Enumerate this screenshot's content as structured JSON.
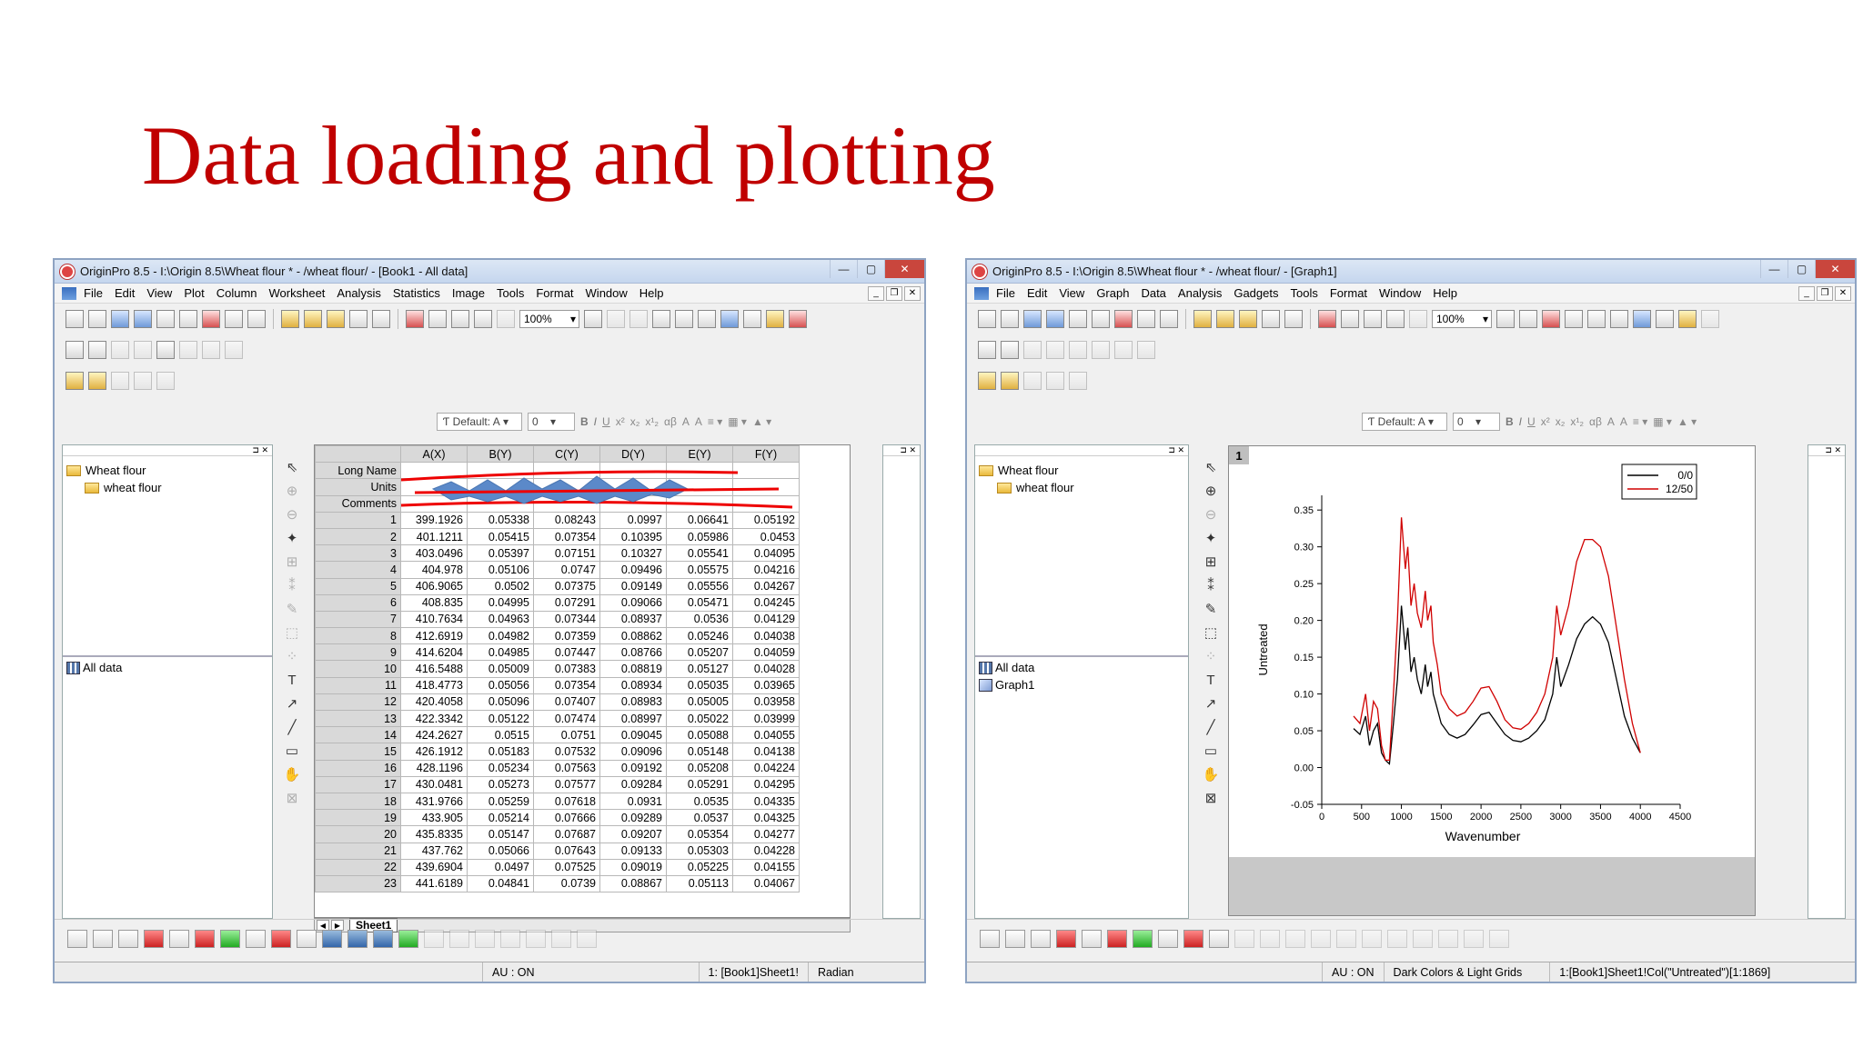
{
  "slide": {
    "title": "Data loading and plotting"
  },
  "left_window": {
    "title": "OriginPro 8.5 - I:\\Origin 8.5\\Wheat flour * - /wheat flour/ - [Book1 - All data]",
    "menu": [
      "File",
      "Edit",
      "View",
      "Plot",
      "Column",
      "Worksheet",
      "Analysis",
      "Statistics",
      "Image",
      "Tools",
      "Format",
      "Window",
      "Help"
    ],
    "zoom": "100%",
    "font_default": "Default: A",
    "font_size": "0",
    "project_tree": {
      "root": "Wheat flour",
      "child": "wheat flour"
    },
    "window_list": [
      "All data"
    ],
    "worksheet": {
      "columns": [
        "A(X)",
        "B(Y)",
        "C(Y)",
        "D(Y)",
        "E(Y)",
        "F(Y)"
      ],
      "meta_rows": [
        "Long Name",
        "Units",
        "Comments"
      ],
      "rows": [
        [
          "1",
          "399.1926",
          "0.05338",
          "0.08243",
          "0.0997",
          "0.06641",
          "0.05192"
        ],
        [
          "2",
          "401.1211",
          "0.05415",
          "0.07354",
          "0.10395",
          "0.05986",
          "0.0453"
        ],
        [
          "3",
          "403.0496",
          "0.05397",
          "0.07151",
          "0.10327",
          "0.05541",
          "0.04095"
        ],
        [
          "4",
          "404.978",
          "0.05106",
          "0.0747",
          "0.09496",
          "0.05575",
          "0.04216"
        ],
        [
          "5",
          "406.9065",
          "0.0502",
          "0.07375",
          "0.09149",
          "0.05556",
          "0.04267"
        ],
        [
          "6",
          "408.835",
          "0.04995",
          "0.07291",
          "0.09066",
          "0.05471",
          "0.04245"
        ],
        [
          "7",
          "410.7634",
          "0.04963",
          "0.07344",
          "0.08937",
          "0.0536",
          "0.04129"
        ],
        [
          "8",
          "412.6919",
          "0.04982",
          "0.07359",
          "0.08862",
          "0.05246",
          "0.04038"
        ],
        [
          "9",
          "414.6204",
          "0.04985",
          "0.07447",
          "0.08766",
          "0.05207",
          "0.04059"
        ],
        [
          "10",
          "416.5488",
          "0.05009",
          "0.07383",
          "0.08819",
          "0.05127",
          "0.04028"
        ],
        [
          "11",
          "418.4773",
          "0.05056",
          "0.07354",
          "0.08934",
          "0.05035",
          "0.03965"
        ],
        [
          "12",
          "420.4058",
          "0.05096",
          "0.07407",
          "0.08983",
          "0.05005",
          "0.03958"
        ],
        [
          "13",
          "422.3342",
          "0.05122",
          "0.07474",
          "0.08997",
          "0.05022",
          "0.03999"
        ],
        [
          "14",
          "424.2627",
          "0.0515",
          "0.0751",
          "0.09045",
          "0.05088",
          "0.04055"
        ],
        [
          "15",
          "426.1912",
          "0.05183",
          "0.07532",
          "0.09096",
          "0.05148",
          "0.04138"
        ],
        [
          "16",
          "428.1196",
          "0.05234",
          "0.07563",
          "0.09192",
          "0.05208",
          "0.04224"
        ],
        [
          "17",
          "430.0481",
          "0.05273",
          "0.07577",
          "0.09284",
          "0.05291",
          "0.04295"
        ],
        [
          "18",
          "431.9766",
          "0.05259",
          "0.07618",
          "0.0931",
          "0.0535",
          "0.04335"
        ],
        [
          "19",
          "433.905",
          "0.05214",
          "0.07666",
          "0.09289",
          "0.0537",
          "0.04325"
        ],
        [
          "20",
          "435.8335",
          "0.05147",
          "0.07687",
          "0.09207",
          "0.05354",
          "0.04277"
        ],
        [
          "21",
          "437.762",
          "0.05066",
          "0.07643",
          "0.09133",
          "0.05303",
          "0.04228"
        ],
        [
          "22",
          "439.6904",
          "0.0497",
          "0.07525",
          "0.09019",
          "0.05225",
          "0.04155"
        ],
        [
          "23",
          "441.6189",
          "0.04841",
          "0.0739",
          "0.08867",
          "0.05113",
          "0.04067"
        ]
      ],
      "sheet_tab": "Sheet1"
    },
    "status": {
      "au": "AU : ON",
      "ref": "1: [Book1]Sheet1!",
      "angle": "Radian"
    }
  },
  "right_window": {
    "title": "OriginPro 8.5 - I:\\Origin 8.5\\Wheat flour * - /wheat flour/ - [Graph1]",
    "menu": [
      "File",
      "Edit",
      "View",
      "Graph",
      "Data",
      "Analysis",
      "Gadgets",
      "Tools",
      "Format",
      "Window",
      "Help"
    ],
    "zoom": "100%",
    "font_default": "Default: A",
    "font_size": "0",
    "project_tree": {
      "root": "Wheat flour",
      "child": "wheat flour"
    },
    "window_list": [
      "All data",
      "Graph1"
    ],
    "layer": "1",
    "status": {
      "au": "AU : ON",
      "theme": "Dark Colors & Light Grids",
      "ref": "1:[Book1]Sheet1!Col(\"Untreated\")[1:1869]"
    }
  },
  "chart_data": {
    "type": "line",
    "xlabel": "Wavenumber",
    "ylabel": "Untreated",
    "xlim": [
      0,
      4500
    ],
    "ylim": [
      -0.05,
      0.37
    ],
    "xticks": [
      0,
      500,
      1000,
      1500,
      2000,
      2500,
      3000,
      3500,
      4000,
      4500
    ],
    "yticks": [
      "-0.05",
      "0.00",
      "0.05",
      "0.10",
      "0.15",
      "0.20",
      "0.25",
      "0.30",
      "0.35"
    ],
    "legend_position": "top-right",
    "series": [
      {
        "name": "0/0",
        "color": "#000000",
        "points": [
          [
            400,
            0.053
          ],
          [
            480,
            0.045
          ],
          [
            550,
            0.07
          ],
          [
            600,
            0.03
          ],
          [
            650,
            0.05
          ],
          [
            700,
            0.06
          ],
          [
            750,
            0.02
          ],
          [
            800,
            0.01
          ],
          [
            850,
            0.005
          ],
          [
            900,
            0.06
          ],
          [
            950,
            0.12
          ],
          [
            1000,
            0.22
          ],
          [
            1050,
            0.16
          ],
          [
            1080,
            0.19
          ],
          [
            1120,
            0.13
          ],
          [
            1160,
            0.15
          ],
          [
            1200,
            0.12
          ],
          [
            1250,
            0.1
          ],
          [
            1300,
            0.14
          ],
          [
            1330,
            0.11
          ],
          [
            1370,
            0.13
          ],
          [
            1400,
            0.1
          ],
          [
            1450,
            0.08
          ],
          [
            1500,
            0.06
          ],
          [
            1600,
            0.045
          ],
          [
            1700,
            0.04
          ],
          [
            1800,
            0.045
          ],
          [
            1900,
            0.058
          ],
          [
            2000,
            0.072
          ],
          [
            2100,
            0.075
          ],
          [
            2200,
            0.06
          ],
          [
            2300,
            0.045
          ],
          [
            2400,
            0.037
          ],
          [
            2500,
            0.035
          ],
          [
            2600,
            0.04
          ],
          [
            2700,
            0.05
          ],
          [
            2800,
            0.065
          ],
          [
            2900,
            0.1
          ],
          [
            2950,
            0.15
          ],
          [
            3000,
            0.11
          ],
          [
            3100,
            0.14
          ],
          [
            3200,
            0.175
          ],
          [
            3300,
            0.195
          ],
          [
            3400,
            0.205
          ],
          [
            3500,
            0.195
          ],
          [
            3600,
            0.17
          ],
          [
            3700,
            0.12
          ],
          [
            3800,
            0.07
          ],
          [
            3900,
            0.04
          ],
          [
            4000,
            0.02
          ]
        ]
      },
      {
        "name": "12/50",
        "color": "#d00000",
        "points": [
          [
            400,
            0.07
          ],
          [
            480,
            0.06
          ],
          [
            550,
            0.1
          ],
          [
            600,
            0.05
          ],
          [
            650,
            0.09
          ],
          [
            700,
            0.08
          ],
          [
            750,
            0.03
          ],
          [
            800,
            0.01
          ],
          [
            850,
            0.01
          ],
          [
            900,
            0.1
          ],
          [
            950,
            0.2
          ],
          [
            1000,
            0.34
          ],
          [
            1050,
            0.27
          ],
          [
            1080,
            0.3
          ],
          [
            1120,
            0.22
          ],
          [
            1160,
            0.25
          ],
          [
            1200,
            0.21
          ],
          [
            1250,
            0.19
          ],
          [
            1300,
            0.24
          ],
          [
            1330,
            0.2
          ],
          [
            1370,
            0.22
          ],
          [
            1400,
            0.17
          ],
          [
            1450,
            0.14
          ],
          [
            1500,
            0.1
          ],
          [
            1600,
            0.08
          ],
          [
            1700,
            0.07
          ],
          [
            1800,
            0.075
          ],
          [
            1900,
            0.09
          ],
          [
            2000,
            0.108
          ],
          [
            2100,
            0.11
          ],
          [
            2200,
            0.09
          ],
          [
            2300,
            0.065
          ],
          [
            2400,
            0.054
          ],
          [
            2500,
            0.052
          ],
          [
            2600,
            0.06
          ],
          [
            2700,
            0.075
          ],
          [
            2800,
            0.1
          ],
          [
            2900,
            0.15
          ],
          [
            2950,
            0.22
          ],
          [
            3000,
            0.18
          ],
          [
            3100,
            0.22
          ],
          [
            3200,
            0.28
          ],
          [
            3300,
            0.31
          ],
          [
            3400,
            0.31
          ],
          [
            3500,
            0.3
          ],
          [
            3600,
            0.26
          ],
          [
            3700,
            0.19
          ],
          [
            3800,
            0.12
          ],
          [
            3900,
            0.06
          ],
          [
            4000,
            0.02
          ]
        ]
      }
    ]
  }
}
